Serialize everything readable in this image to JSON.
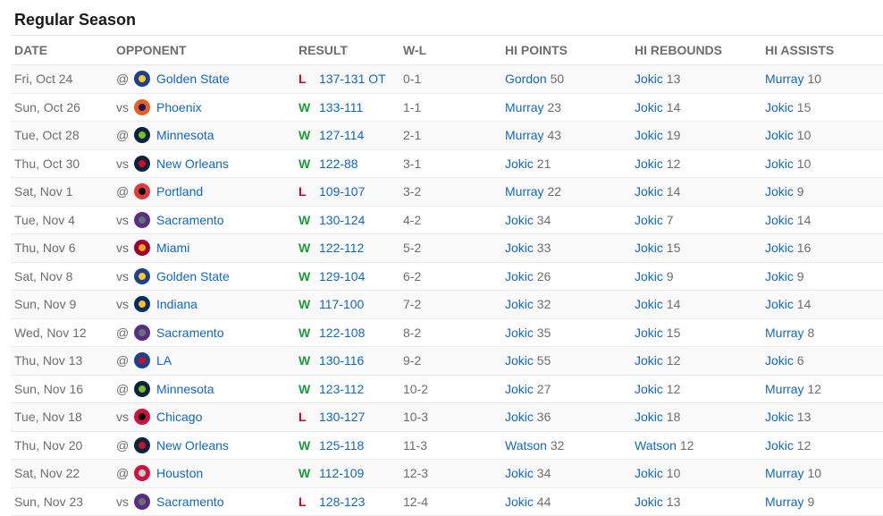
{
  "title": "Regular Season",
  "headers": [
    "DATE",
    "OPPONENT",
    "RESULT",
    "W-L",
    "HI POINTS",
    "HI REBOUNDS",
    "HI ASSISTS"
  ],
  "rows": [
    {
      "date": "Fri, Oct 24",
      "prefix": "@",
      "team": "Golden State",
      "logo": "golden-state-logo",
      "color": "#1d428a",
      "accent": "#ffc72c",
      "result": "L",
      "score": "137-131 OT",
      "wl": "0-1",
      "pts_name": "Gordon",
      "pts": "50",
      "reb_name": "Jokic",
      "reb": "13",
      "ast_name": "Murray",
      "ast": "10"
    },
    {
      "date": "Sun, Oct 26",
      "prefix": "vs",
      "team": "Phoenix",
      "logo": "phoenix-logo",
      "color": "#e56020",
      "accent": "#1d1160",
      "result": "W",
      "score": "133-111",
      "wl": "1-1",
      "pts_name": "Murray",
      "pts": "23",
      "reb_name": "Jokic",
      "reb": "14",
      "ast_name": "Jokic",
      "ast": "15"
    },
    {
      "date": "Tue, Oct 28",
      "prefix": "@",
      "team": "Minnesota",
      "logo": "minnesota-logo",
      "color": "#0c2340",
      "accent": "#78be20",
      "result": "W",
      "score": "127-114",
      "wl": "2-1",
      "pts_name": "Murray",
      "pts": "43",
      "reb_name": "Jokic",
      "reb": "19",
      "ast_name": "Jokic",
      "ast": "10"
    },
    {
      "date": "Thu, Oct 30",
      "prefix": "vs",
      "team": "New Orleans",
      "logo": "new-orleans-logo",
      "color": "#0c2340",
      "accent": "#c8102e",
      "result": "W",
      "score": "122-88",
      "wl": "3-1",
      "pts_name": "Jokic",
      "pts": "21",
      "reb_name": "Jokic",
      "reb": "12",
      "ast_name": "Jokic",
      "ast": "10"
    },
    {
      "date": "Sat, Nov 1",
      "prefix": "@",
      "team": "Portland",
      "logo": "portland-logo",
      "color": "#e03a3e",
      "accent": "#000000",
      "result": "L",
      "score": "109-107",
      "wl": "3-2",
      "pts_name": "Murray",
      "pts": "22",
      "reb_name": "Jokic",
      "reb": "14",
      "ast_name": "Jokic",
      "ast": "9"
    },
    {
      "date": "Tue, Nov 4",
      "prefix": "vs",
      "team": "Sacramento",
      "logo": "sacramento-logo",
      "color": "#5a2d81",
      "accent": "#63727a",
      "result": "W",
      "score": "130-124",
      "wl": "4-2",
      "pts_name": "Jokic",
      "pts": "34",
      "reb_name": "Jokic",
      "reb": "7",
      "ast_name": "Jokic",
      "ast": "14"
    },
    {
      "date": "Thu, Nov 6",
      "prefix": "vs",
      "team": "Miami",
      "logo": "miami-logo",
      "color": "#98002e",
      "accent": "#f9a01b",
      "result": "W",
      "score": "122-112",
      "wl": "5-2",
      "pts_name": "Jokic",
      "pts": "33",
      "reb_name": "Jokic",
      "reb": "15",
      "ast_name": "Jokic",
      "ast": "16"
    },
    {
      "date": "Sat, Nov 8",
      "prefix": "vs",
      "team": "Golden State",
      "logo": "golden-state-logo",
      "color": "#1d428a",
      "accent": "#ffc72c",
      "result": "W",
      "score": "129-104",
      "wl": "6-2",
      "pts_name": "Jokic",
      "pts": "26",
      "reb_name": "Jokic",
      "reb": "9",
      "ast_name": "Jokic",
      "ast": "9"
    },
    {
      "date": "Sun, Nov 9",
      "prefix": "vs",
      "team": "Indiana",
      "logo": "indiana-logo",
      "color": "#002d62",
      "accent": "#fdbb30",
      "result": "W",
      "score": "117-100",
      "wl": "7-2",
      "pts_name": "Jokic",
      "pts": "32",
      "reb_name": "Jokic",
      "reb": "14",
      "ast_name": "Jokic",
      "ast": "14"
    },
    {
      "date": "Wed, Nov 12",
      "prefix": "@",
      "team": "Sacramento",
      "logo": "sacramento-logo",
      "color": "#5a2d81",
      "accent": "#63727a",
      "result": "W",
      "score": "122-108",
      "wl": "8-2",
      "pts_name": "Jokic",
      "pts": "35",
      "reb_name": "Jokic",
      "reb": "15",
      "ast_name": "Murray",
      "ast": "8"
    },
    {
      "date": "Thu, Nov 13",
      "prefix": "@",
      "team": "LA",
      "logo": "la-clippers-logo",
      "color": "#1d428a",
      "accent": "#c8102e",
      "result": "W",
      "score": "130-116",
      "wl": "9-2",
      "pts_name": "Jokic",
      "pts": "55",
      "reb_name": "Jokic",
      "reb": "12",
      "ast_name": "Jokic",
      "ast": "6"
    },
    {
      "date": "Sun, Nov 16",
      "prefix": "@",
      "team": "Minnesota",
      "logo": "minnesota-logo",
      "color": "#0c2340",
      "accent": "#78be20",
      "result": "W",
      "score": "123-112",
      "wl": "10-2",
      "pts_name": "Jokic",
      "pts": "27",
      "reb_name": "Jokic",
      "reb": "12",
      "ast_name": "Murray",
      "ast": "12"
    },
    {
      "date": "Tue, Nov 18",
      "prefix": "vs",
      "team": "Chicago",
      "logo": "chicago-logo",
      "color": "#ce1141",
      "accent": "#000000",
      "result": "L",
      "score": "130-127",
      "wl": "10-3",
      "pts_name": "Jokic",
      "pts": "36",
      "reb_name": "Jokic",
      "reb": "18",
      "ast_name": "Jokic",
      "ast": "13"
    },
    {
      "date": "Thu, Nov 20",
      "prefix": "@",
      "team": "New Orleans",
      "logo": "new-orleans-logo",
      "color": "#0c2340",
      "accent": "#c8102e",
      "result": "W",
      "score": "125-118",
      "wl": "11-3",
      "pts_name": "Watson",
      "pts": "32",
      "reb_name": "Watson",
      "reb": "12",
      "ast_name": "Jokic",
      "ast": "12"
    },
    {
      "date": "Sat, Nov 22",
      "prefix": "@",
      "team": "Houston",
      "logo": "houston-logo",
      "color": "#ce1141",
      "accent": "#c4ced4",
      "result": "W",
      "score": "112-109",
      "wl": "12-3",
      "pts_name": "Jokic",
      "pts": "34",
      "reb_name": "Jokic",
      "reb": "10",
      "ast_name": "Murray",
      "ast": "10"
    },
    {
      "date": "Sun, Nov 23",
      "prefix": "vs",
      "team": "Sacramento",
      "logo": "sacramento-logo",
      "color": "#5a2d81",
      "accent": "#63727a",
      "result": "L",
      "score": "128-123",
      "wl": "12-4",
      "pts_name": "Jokic",
      "pts": "44",
      "reb_name": "Jokic",
      "reb": "13",
      "ast_name": "Murray",
      "ast": "9"
    }
  ]
}
